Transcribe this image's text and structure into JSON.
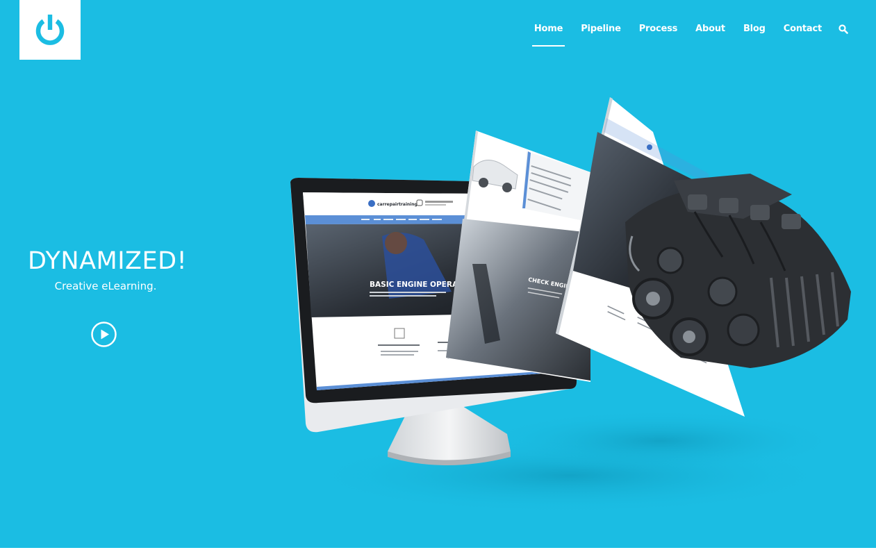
{
  "colors": {
    "background": "#1bbde3",
    "text": "#ffffff",
    "accent_blue": "#5b8fd6",
    "engine_dark": "#2c2f33"
  },
  "logo": {
    "icon": "power-icon"
  },
  "nav": {
    "items": [
      {
        "label": "Home",
        "active": true
      },
      {
        "label": "Pipeline"
      },
      {
        "label": "Process"
      },
      {
        "label": "About"
      },
      {
        "label": "Blog"
      },
      {
        "label": "Contact"
      }
    ],
    "search_icon": "search-icon"
  },
  "hero": {
    "title": "DYNAMIZED!",
    "subtitle": "Creative eLearning.",
    "play_icon": "play-icon"
  },
  "mockup": {
    "brand": "carrepairtraining",
    "screen1_heading": "BASIC ENGINE OPERATION",
    "screen2_heading": "CHECK ENGINE C"
  }
}
